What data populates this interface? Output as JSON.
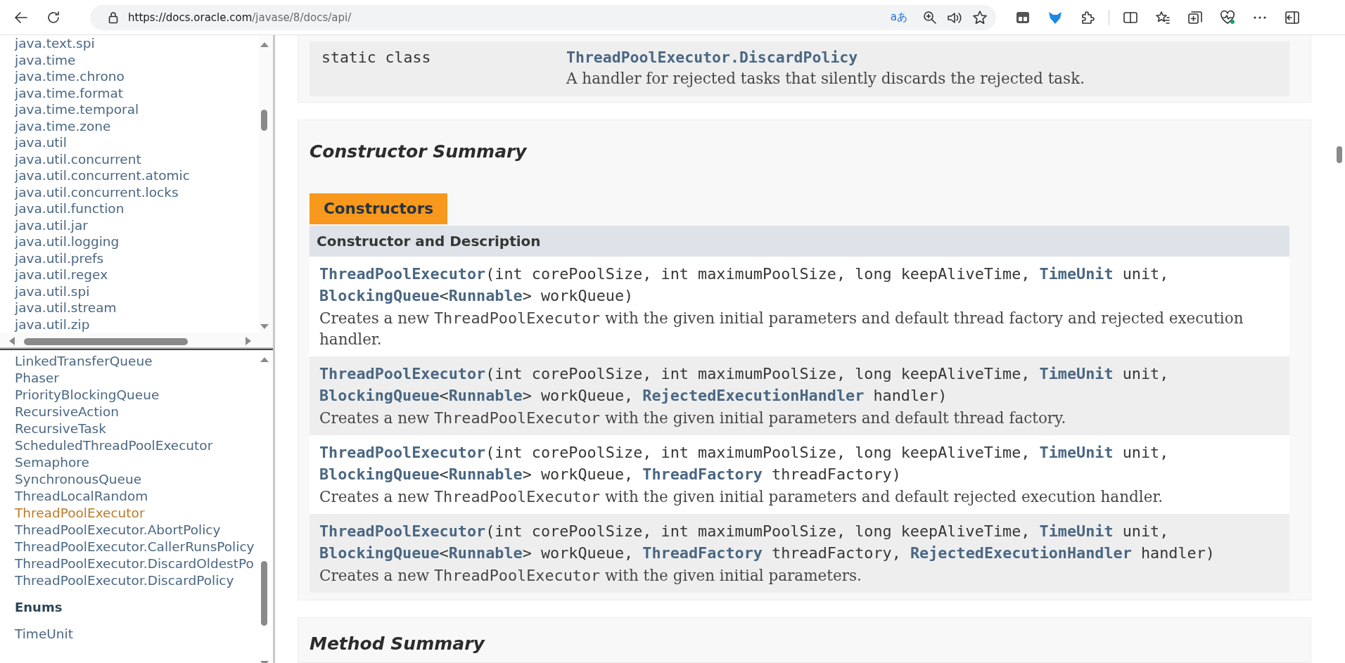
{
  "browser": {
    "url_host": "https://docs.oracle.com",
    "url_path": "/javase/8/docs/api/",
    "translate_glyph": "aあ"
  },
  "packages_frame": {
    "items": [
      "java.text.spi",
      "java.time",
      "java.time.chrono",
      "java.time.format",
      "java.time.temporal",
      "java.time.zone",
      "java.util",
      "java.util.concurrent",
      "java.util.concurrent.atomic",
      "java.util.concurrent.locks",
      "java.util.function",
      "java.util.jar",
      "java.util.logging",
      "java.util.prefs",
      "java.util.regex",
      "java.util.spi",
      "java.util.stream",
      "java.util.zip"
    ]
  },
  "classes_frame": {
    "items": [
      {
        "label": "LinkedTransferQueue",
        "selected": false
      },
      {
        "label": "Phaser",
        "selected": false
      },
      {
        "label": "PriorityBlockingQueue",
        "selected": false
      },
      {
        "label": "RecursiveAction",
        "selected": false
      },
      {
        "label": "RecursiveTask",
        "selected": false
      },
      {
        "label": "ScheduledThreadPoolExecutor",
        "selected": false
      },
      {
        "label": "Semaphore",
        "selected": false
      },
      {
        "label": "SynchronousQueue",
        "selected": false
      },
      {
        "label": "ThreadLocalRandom",
        "selected": false
      },
      {
        "label": "ThreadPoolExecutor",
        "selected": true
      },
      {
        "label": "ThreadPoolExecutor.AbortPolicy",
        "selected": false
      },
      {
        "label": "ThreadPoolExecutor.CallerRunsPolicy",
        "selected": false
      },
      {
        "label": "ThreadPoolExecutor.DiscardOldestPo",
        "selected": false
      },
      {
        "label": "ThreadPoolExecutor.DiscardPolicy",
        "selected": false
      }
    ],
    "enums_heading": "Enums",
    "enums": [
      {
        "label": "TimeUnit",
        "selected": false
      }
    ]
  },
  "nested_summary": {
    "rows": [
      {
        "modifier": "static class",
        "name": "ThreadPoolExecutor.DiscardPolicy",
        "description": "A handler for rejected tasks that silently discards the rejected task."
      }
    ]
  },
  "constructor_summary": {
    "title": "Constructor Summary",
    "tab": "Constructors",
    "column": "Constructor and Description",
    "rows": [
      {
        "signature": [
          {
            "kind": "link",
            "text": "ThreadPoolExecutor"
          },
          {
            "kind": "text",
            "text": "(int corePoolSize, int maximumPoolSize, long keepAliveTime, "
          },
          {
            "kind": "link",
            "text": "TimeUnit"
          },
          {
            "kind": "text",
            "text": " unit, "
          },
          {
            "kind": "link",
            "text": "BlockingQueue"
          },
          {
            "kind": "text",
            "text": "<"
          },
          {
            "kind": "link",
            "text": "Runnable"
          },
          {
            "kind": "text",
            "text": "> workQueue)"
          }
        ],
        "description": [
          {
            "kind": "text",
            "text": "Creates a new "
          },
          {
            "kind": "code",
            "text": "ThreadPoolExecutor"
          },
          {
            "kind": "text",
            "text": " with the given initial parameters and default thread factory and rejected execution handler."
          }
        ]
      },
      {
        "signature": [
          {
            "kind": "link",
            "text": "ThreadPoolExecutor"
          },
          {
            "kind": "text",
            "text": "(int corePoolSize, int maximumPoolSize, long keepAliveTime, "
          },
          {
            "kind": "link",
            "text": "TimeUnit"
          },
          {
            "kind": "text",
            "text": " unit, "
          },
          {
            "kind": "link",
            "text": "BlockingQueue"
          },
          {
            "kind": "text",
            "text": "<"
          },
          {
            "kind": "link",
            "text": "Runnable"
          },
          {
            "kind": "text",
            "text": "> workQueue, "
          },
          {
            "kind": "link",
            "text": "RejectedExecutionHandler"
          },
          {
            "kind": "text",
            "text": " handler)"
          }
        ],
        "description": [
          {
            "kind": "text",
            "text": "Creates a new "
          },
          {
            "kind": "code",
            "text": "ThreadPoolExecutor"
          },
          {
            "kind": "text",
            "text": " with the given initial parameters and default thread factory."
          }
        ]
      },
      {
        "signature": [
          {
            "kind": "link",
            "text": "ThreadPoolExecutor"
          },
          {
            "kind": "text",
            "text": "(int corePoolSize, int maximumPoolSize, long keepAliveTime, "
          },
          {
            "kind": "link",
            "text": "TimeUnit"
          },
          {
            "kind": "text",
            "text": " unit, "
          },
          {
            "kind": "link",
            "text": "BlockingQueue"
          },
          {
            "kind": "text",
            "text": "<"
          },
          {
            "kind": "link",
            "text": "Runnable"
          },
          {
            "kind": "text",
            "text": "> workQueue, "
          },
          {
            "kind": "link",
            "text": "ThreadFactory"
          },
          {
            "kind": "text",
            "text": " threadFactory)"
          }
        ],
        "description": [
          {
            "kind": "text",
            "text": "Creates a new "
          },
          {
            "kind": "code",
            "text": "ThreadPoolExecutor"
          },
          {
            "kind": "text",
            "text": " with the given initial parameters and default rejected execution handler."
          }
        ]
      },
      {
        "signature": [
          {
            "kind": "link",
            "text": "ThreadPoolExecutor"
          },
          {
            "kind": "text",
            "text": "(int corePoolSize, int maximumPoolSize, long keepAliveTime, "
          },
          {
            "kind": "link",
            "text": "TimeUnit"
          },
          {
            "kind": "text",
            "text": " unit, "
          },
          {
            "kind": "link",
            "text": "BlockingQueue"
          },
          {
            "kind": "text",
            "text": "<"
          },
          {
            "kind": "link",
            "text": "Runnable"
          },
          {
            "kind": "text",
            "text": "> workQueue, "
          },
          {
            "kind": "link",
            "text": "ThreadFactory"
          },
          {
            "kind": "text",
            "text": " threadFactory, "
          },
          {
            "kind": "link",
            "text": "RejectedExecutionHandler"
          },
          {
            "kind": "text",
            "text": " handler)"
          }
        ],
        "description": [
          {
            "kind": "text",
            "text": "Creates a new "
          },
          {
            "kind": "code",
            "text": "ThreadPoolExecutor"
          },
          {
            "kind": "text",
            "text": " with the given initial parameters."
          }
        ]
      }
    ]
  },
  "method_summary": {
    "title": "Method Summary"
  }
}
